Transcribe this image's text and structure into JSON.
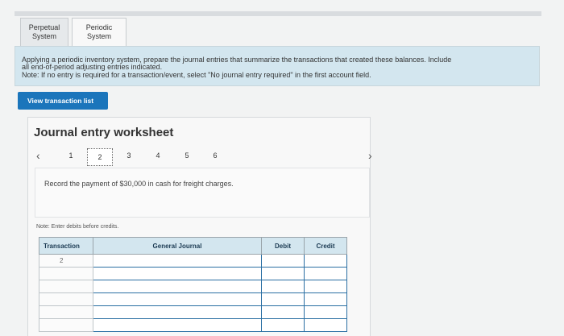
{
  "tabs": [
    {
      "line1": "Perpetual",
      "line2": "System"
    },
    {
      "line1": "Periodic",
      "line2": "System"
    }
  ],
  "instructions": {
    "line1": "Applying a periodic inventory system, prepare the journal entries that summarize the transactions that created these balances. Include",
    "line2": "all end-of-period adjusting entries indicated.",
    "note": "Note: If no entry is required for a transaction/event, select \"No journal entry required\" in the first account field."
  },
  "view_button": "View transaction list",
  "worksheet": {
    "title": "Journal entry worksheet",
    "pages": [
      "1",
      "2",
      "3",
      "4",
      "5",
      "6"
    ],
    "active_page": "2",
    "record_text": "Record the payment of $30,000 in cash for freight charges.",
    "note": "Note: Enter debits before credits."
  },
  "table": {
    "headers": [
      "Transaction",
      "General Journal",
      "Debit",
      "Credit"
    ],
    "transaction": "2"
  },
  "icons": {
    "prev": "chevron-left-icon",
    "next": "chevron-right-icon"
  },
  "colors": {
    "accent": "#1b75bb",
    "panel": "#d3e6ef"
  }
}
